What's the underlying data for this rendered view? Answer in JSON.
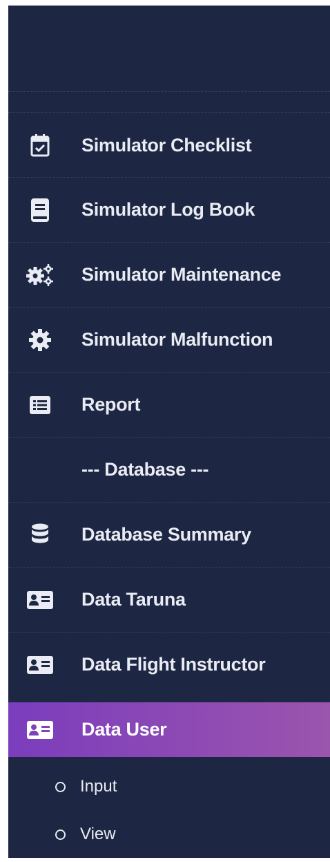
{
  "menu": {
    "items": [
      {
        "label": "Simulator Checklist",
        "icon": "calendar-check-icon"
      },
      {
        "label": "Simulator Log Book",
        "icon": "book-icon"
      },
      {
        "label": "Simulator Maintenance",
        "icon": "gears-icon"
      },
      {
        "label": "Simulator Malfunction",
        "icon": "gear-icon"
      },
      {
        "label": "Report",
        "icon": "list-alt-icon"
      },
      {
        "label": "--- Database ---"
      },
      {
        "label": "Database Summary",
        "icon": "database-icon"
      },
      {
        "label": "Data Taruna",
        "icon": "id-card-icon"
      },
      {
        "label": "Data Flight Instructor",
        "icon": "id-card-icon"
      },
      {
        "label": "Data User",
        "icon": "id-card-icon",
        "active": true
      }
    ],
    "subitems": [
      {
        "label": "Input",
        "icon": "circle-outline-icon"
      },
      {
        "label": "View",
        "icon": "circle-outline-icon"
      }
    ]
  },
  "colors": {
    "sidebar_bg": "#1d2643",
    "active_gradient_start": "#7b3dbd",
    "active_gradient_end": "#9a55ad",
    "text": "#e9ecf3"
  }
}
